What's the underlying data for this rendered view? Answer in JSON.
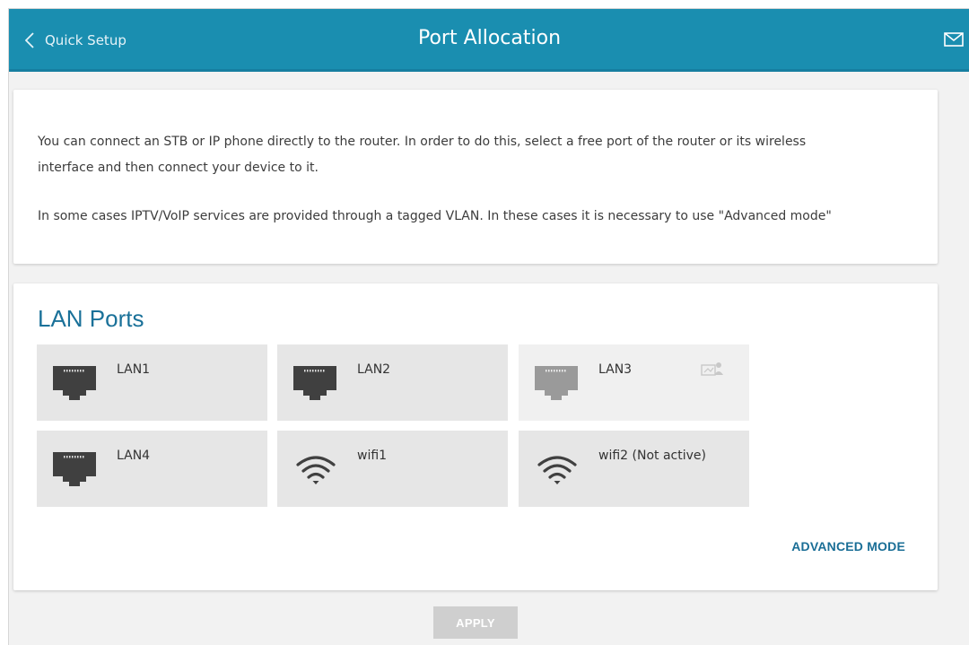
{
  "header": {
    "back_label": "Quick Setup",
    "title": "Port Allocation",
    "accent_color": "#1a8eb0"
  },
  "info": {
    "paragraph1_line1": "You can connect an STB or IP phone directly to the router. In order to do this, select a free port of the router or its wireless",
    "paragraph1_line2": "interface and then connect your device to it.",
    "paragraph2": "In some cases IPTV/VoIP services are provided through a tagged VLAN. In these cases it is necessary to use \"Advanced mode\""
  },
  "lan_ports": {
    "title": "LAN Ports",
    "ports": [
      {
        "label": "LAN1",
        "icon": "ethernet-port-icon",
        "state": "available"
      },
      {
        "label": "LAN2",
        "icon": "ethernet-port-icon",
        "state": "available"
      },
      {
        "label": "LAN3",
        "icon": "ethernet-port-icon",
        "state": "in-use",
        "badge_icon": "connected-device-icon"
      },
      {
        "label": "LAN4",
        "icon": "ethernet-port-icon",
        "state": "available"
      },
      {
        "label": "wifi1",
        "icon": "wifi-icon",
        "state": "available"
      },
      {
        "label": "wifi2 (Not active)",
        "icon": "wifi-icon",
        "state": "inactive"
      }
    ],
    "advanced_mode_label": "ADVANCED MODE"
  },
  "footer": {
    "apply_label": "APPLY"
  }
}
